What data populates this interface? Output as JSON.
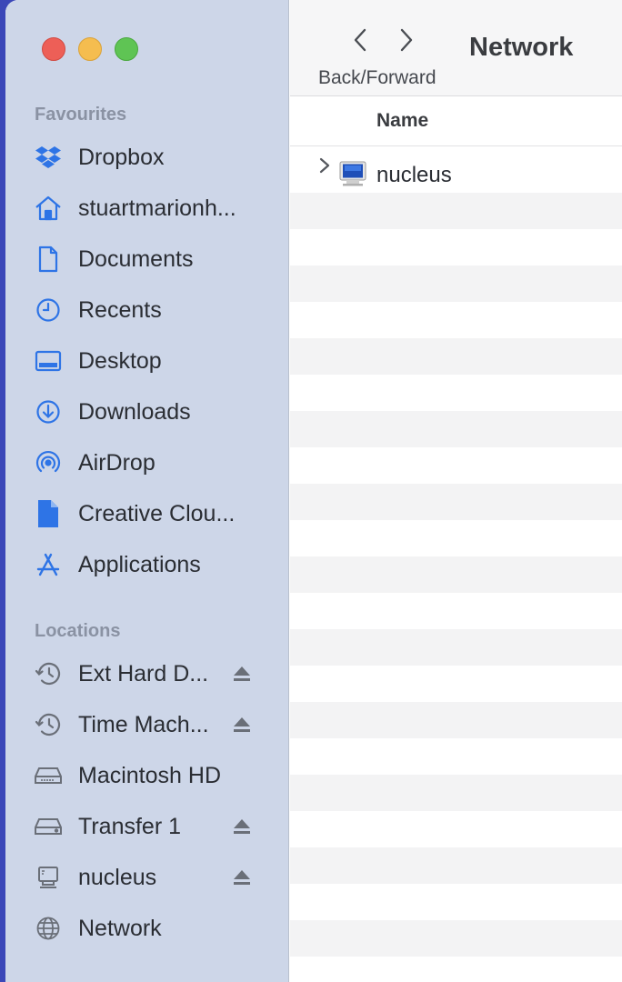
{
  "window": {
    "title": "Network"
  },
  "toolbar": {
    "nav_caption": "Back/Forward"
  },
  "colors": {
    "accent": "#2e74e6",
    "sidebar_bg": "#cdd6e8",
    "desktop_bg": "#3b47b8"
  },
  "sidebar": {
    "favourites_title": "Favourites",
    "favourites": [
      {
        "label": "Dropbox",
        "icon": "dropbox-icon"
      },
      {
        "label": "stuartmarionh...",
        "icon": "home-icon"
      },
      {
        "label": "Documents",
        "icon": "document-icon"
      },
      {
        "label": "Recents",
        "icon": "clock-icon"
      },
      {
        "label": "Desktop",
        "icon": "desktop-icon"
      },
      {
        "label": "Downloads",
        "icon": "download-icon"
      },
      {
        "label": "AirDrop",
        "icon": "airdrop-icon"
      },
      {
        "label": "Creative Clou...",
        "icon": "file-icon"
      },
      {
        "label": "Applications",
        "icon": "applications-icon"
      }
    ],
    "locations_title": "Locations",
    "locations": [
      {
        "label": "Ext Hard D...",
        "icon": "time-machine-icon",
        "ejectable": true
      },
      {
        "label": "Time Mach...",
        "icon": "time-machine-icon",
        "ejectable": true
      },
      {
        "label": "Macintosh HD",
        "icon": "internal-drive-icon",
        "ejectable": false
      },
      {
        "label": "Transfer 1",
        "icon": "external-drive-icon",
        "ejectable": true
      },
      {
        "label": "nucleus",
        "icon": "computer-icon",
        "ejectable": true
      },
      {
        "label": "Network",
        "icon": "globe-icon",
        "ejectable": false
      }
    ]
  },
  "list": {
    "column_name": "Name",
    "items": [
      {
        "name": "nucleus",
        "icon": "networked-computer-icon"
      }
    ]
  }
}
